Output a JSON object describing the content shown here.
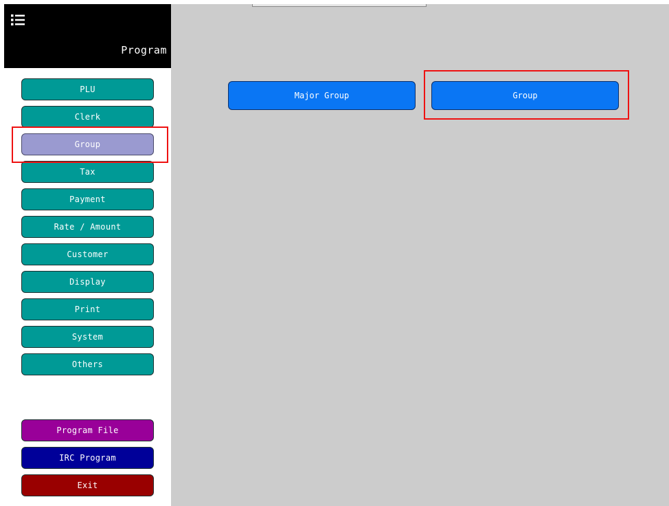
{
  "sidebar": {
    "title": "Program",
    "menu_icon": "list-menu-icon",
    "items": [
      {
        "label": "PLU",
        "state": "normal"
      },
      {
        "label": "Clerk",
        "state": "normal"
      },
      {
        "label": "Group",
        "state": "selected"
      },
      {
        "label": "Tax",
        "state": "normal"
      },
      {
        "label": "Payment",
        "state": "normal"
      },
      {
        "label": "Rate / Amount",
        "state": "normal"
      },
      {
        "label": "Customer",
        "state": "normal"
      },
      {
        "label": "Display",
        "state": "normal"
      },
      {
        "label": "Print",
        "state": "normal"
      },
      {
        "label": "System",
        "state": "normal"
      },
      {
        "label": "Others",
        "state": "normal"
      }
    ],
    "bottom_items": [
      {
        "label": "Program File"
      },
      {
        "label": "IRC Program"
      },
      {
        "label": "Exit"
      }
    ]
  },
  "main": {
    "buttons": [
      {
        "label": "Major Group"
      },
      {
        "label": "Group"
      }
    ]
  },
  "colors": {
    "sidebar_header": "#000000",
    "teal_button": "#009a96",
    "selected_button": "#9a9ad0",
    "program_file_button": "#990099",
    "irc_program_button": "#000099",
    "exit_button": "#990000",
    "main_background": "#cccccc",
    "main_button": "#0a76f4",
    "highlight": "#ee1111"
  }
}
